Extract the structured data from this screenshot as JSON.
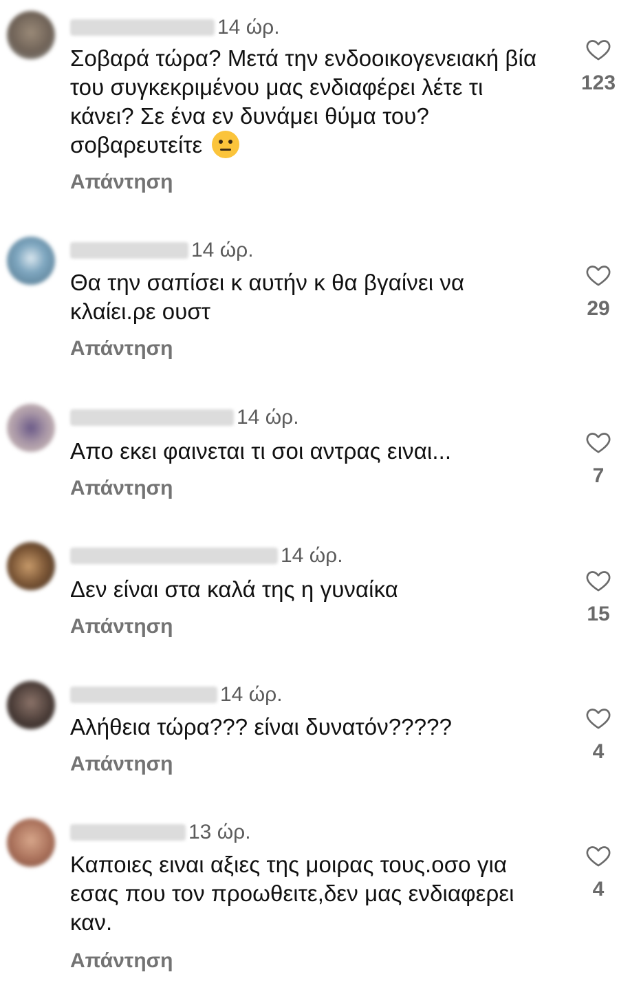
{
  "comments": [
    {
      "time": "14 ώρ.",
      "text": "Σοβαρά τώρα? Μετά την ενδοοικογενειακή βία του συγκεκριμένου μας ενδιαφέρει λέτε τι κάνει? Σε ένα εν δυνάμει θύμα του? σοβαρευτείτε",
      "emoji": "face-with-raised-eyebrow",
      "reply_label": "Απάντηση",
      "likes": "123"
    },
    {
      "time": "14 ώρ.",
      "text": "Θα την σαπίσει κ αυτήν κ θα βγαίνει να κλαίει.ρε ουστ",
      "reply_label": "Απάντηση",
      "likes": "29"
    },
    {
      "time": "14 ώρ.",
      "text": "Απο εκει φαινεται τι σοι αντρας ειναι...",
      "reply_label": "Απάντηση",
      "likes": "7"
    },
    {
      "time": "14 ώρ.",
      "text": "Δεν είναι στα καλά της η γυναίκα",
      "reply_label": "Απάντηση",
      "likes": "15"
    },
    {
      "time": "14 ώρ.",
      "text": "Αλήθεια τώρα??? είναι δυνατόν?????",
      "reply_label": "Απάντηση",
      "likes": "4"
    },
    {
      "time": "13 ώρ.",
      "text": "Καποιες ειναι αξιες της μοιρας τους.οσο για εσας που τον προωθειτε,δεν μας ενδιαφερει καν.",
      "reply_label": "Απάντηση",
      "likes": "4"
    }
  ],
  "icons": {
    "like": "heart-outline-icon"
  },
  "colors": {
    "background": "#ffffff",
    "text": "#111111",
    "secondary": "#737373"
  }
}
